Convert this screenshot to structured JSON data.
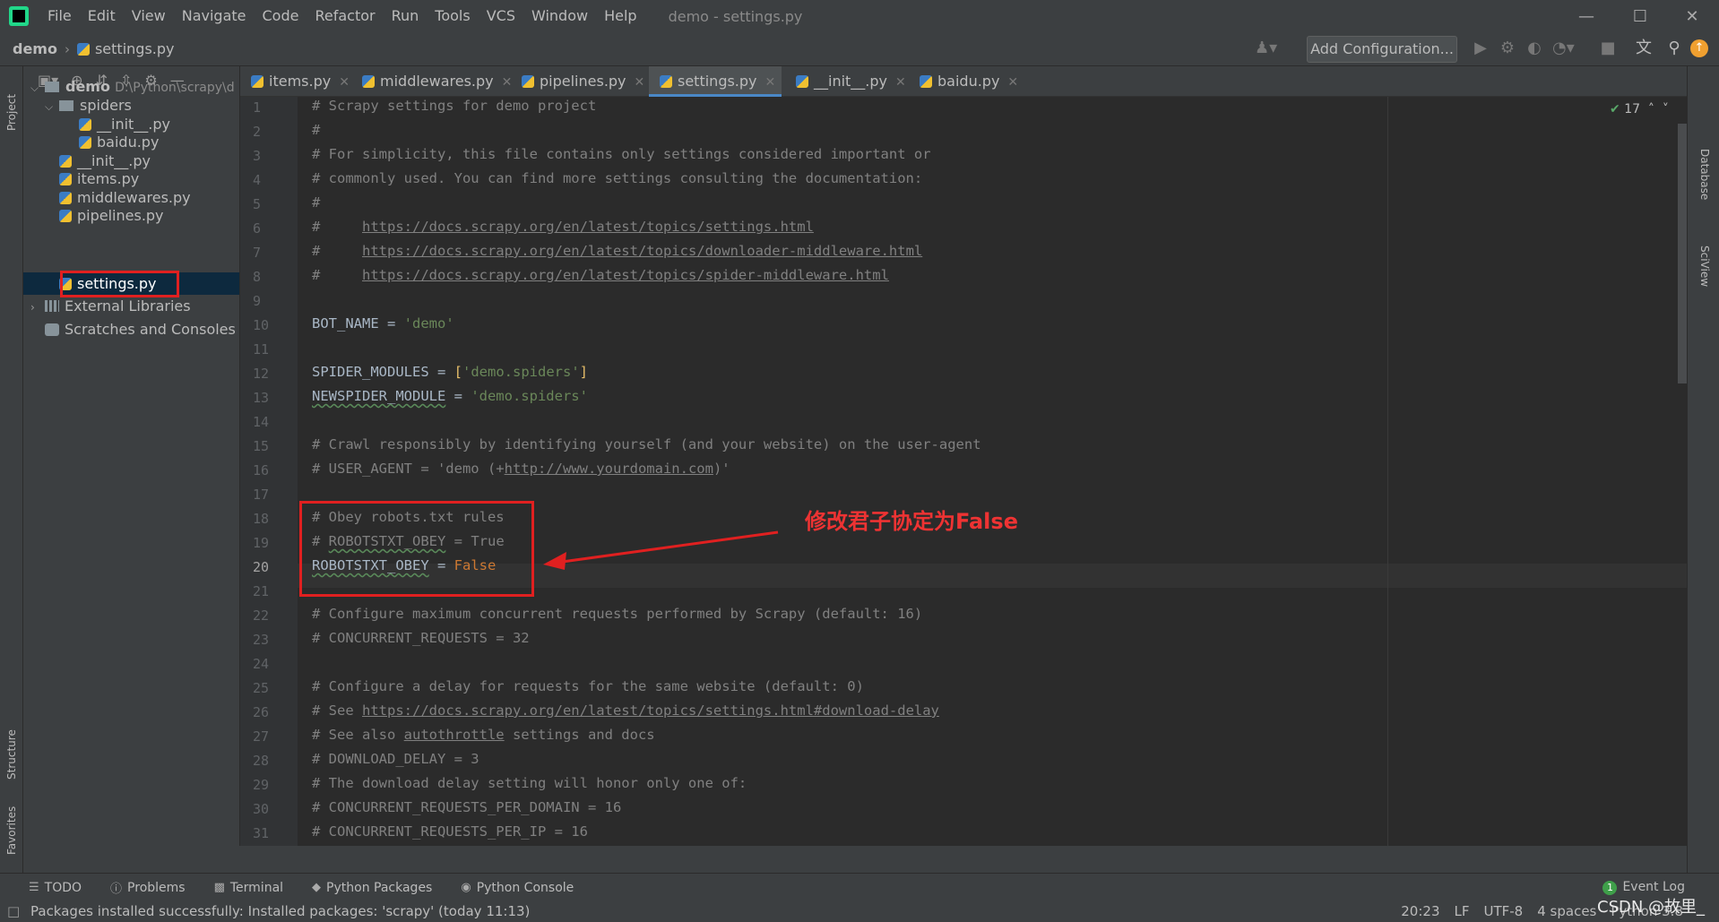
{
  "app": {
    "title": "demo - settings.py"
  },
  "menu": [
    "File",
    "Edit",
    "View",
    "Navigate",
    "Code",
    "Refactor",
    "Run",
    "Tools",
    "VCS",
    "Window",
    "Help"
  ],
  "nav": {
    "project": "demo",
    "file": "settings.py",
    "run_config": "Add Configuration..."
  },
  "side_labels": {
    "project": "Project",
    "structure": "Structure",
    "favorites": "Favorites",
    "database": "Database",
    "sciview": "SciView"
  },
  "tree": {
    "root": "demo",
    "root_path": "D:\\Python\\scrapy\\d",
    "spiders": "spiders",
    "spider_init": "__init__.py",
    "spider_baidu": "baidu.py",
    "init": "__init__.py",
    "items": "items.py",
    "middlewares": "middlewares.py",
    "pipelines": "pipelines.py",
    "settings": "settings.py",
    "ext_libs": "External Libraries",
    "scratches": "Scratches and Consoles"
  },
  "tabs": [
    {
      "label": "items.py"
    },
    {
      "label": "middlewares.py"
    },
    {
      "label": "pipelines.py"
    },
    {
      "label": "settings.py"
    },
    {
      "label": "__init__.py"
    },
    {
      "label": "baidu.py"
    }
  ],
  "inspections": {
    "count": "17"
  },
  "code": {
    "l1": "# Scrapy settings for demo project",
    "l2": "#",
    "l3": "# For simplicity, this file contains only settings considered important or",
    "l4": "# commonly used. You can find more settings consulting the documentation:",
    "l5": "#",
    "l6_link": "https://docs.scrapy.org/en/latest/topics/settings.html",
    "l7_link": "https://docs.scrapy.org/en/latest/topics/downloader-middleware.html",
    "l8_link": "https://docs.scrapy.org/en/latest/topics/spider-middleware.html",
    "l10_name": "BOT_NAME",
    "l10_val": "'demo'",
    "l12_name": "SPIDER_MODULES",
    "l12_val": "'demo.spiders'",
    "l13_name": "NEWSPIDER_MODULE",
    "l13_val": "'demo.spiders'",
    "l15": "# Crawl responsibly by identifying yourself (and your website) on the user-agent",
    "l16_a": "# USER_AGENT = 'demo (+",
    "l16_link": "http://www.yourdomain.com",
    "l16_b": ")'",
    "l18": "# Obey robots.txt rules",
    "l19_a": "# ",
    "l19_name": "ROBOTSTXT_OBEY",
    "l19_b": " = True",
    "l20_name": "ROBOTSTXT_OBEY",
    "l20_val": "False",
    "l22": "# Configure maximum concurrent requests performed by Scrapy (default: 16)",
    "l23": "# CONCURRENT_REQUESTS = 32",
    "l25": "# Configure a delay for requests for the same website (default: 0)",
    "l26_a": "# See ",
    "l26_link": "https://docs.scrapy.org/en/latest/topics/settings.html#download-delay",
    "l27_a": "# See also ",
    "l27_link": "autothrottle",
    "l27_b": " settings and docs",
    "l28": "# DOWNLOAD_DELAY = 3",
    "l29": "# The download delay setting will honor only one of:",
    "l30": "# CONCURRENT_REQUESTS_PER_DOMAIN = 16",
    "l31": "# CONCURRENT_REQUESTS_PER_IP = 16"
  },
  "annotation": {
    "text": "修改君子协定为False",
    "color": "#e02020"
  },
  "tool_windows": [
    "TODO",
    "Problems",
    "Terminal",
    "Python Packages",
    "Python Console"
  ],
  "event_log": {
    "label": "Event Log",
    "count": "1"
  },
  "status": {
    "message": "Packages installed successfully: Installed packages: 'scrapy' (today 11:13)",
    "position": "20:23",
    "line_sep": "LF",
    "encoding": "UTF-8",
    "indent": "4 spaces",
    "interpreter": "Python 3.8"
  },
  "watermark": "CSDN @故里_"
}
